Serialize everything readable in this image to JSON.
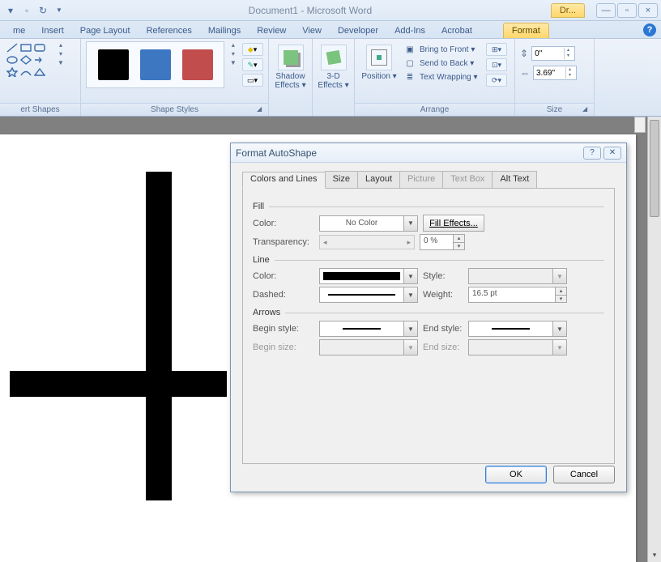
{
  "titlebar": {
    "title": "Document1 - Microsoft Word",
    "tool_tab": "Dr..."
  },
  "ribbon_tabs": {
    "t0": "me",
    "insert": "Insert",
    "page_layout": "Page Layout",
    "references": "References",
    "mailings": "Mailings",
    "review": "Review",
    "view": "View",
    "developer": "Developer",
    "addins": "Add-Ins",
    "acrobat": "Acrobat",
    "format": "Format"
  },
  "groups": {
    "insert_shapes": "ert Shapes",
    "shape_styles": "Shape Styles",
    "shadow": {
      "label": "Shadow Effects ▾"
    },
    "threeD": {
      "label": "3-D Effects ▾"
    },
    "position": {
      "label": "Position ▾"
    },
    "arrange": "Arrange",
    "bring_front": "Bring to Front ▾",
    "send_back": "Send to Back ▾",
    "text_wrap": "Text Wrapping ▾",
    "size": "Size",
    "height": "0\"",
    "width": "3.69\""
  },
  "dialog": {
    "title": "Format AutoShape",
    "tabs": {
      "colors_lines": "Colors and Lines",
      "size": "Size",
      "layout": "Layout",
      "picture": "Picture",
      "text_box": "Text Box",
      "alt_text": "Alt Text"
    },
    "fill": {
      "group": "Fill",
      "color_label": "Color:",
      "color_value": "No Color",
      "effects_btn": "Fill Effects...",
      "transparency_label": "Transparency:",
      "transparency_value": "0 %"
    },
    "line": {
      "group": "Line",
      "color_label": "Color:",
      "dashed_label": "Dashed:",
      "style_label": "Style:",
      "weight_label": "Weight:",
      "weight_value": "16.5 pt"
    },
    "arrows": {
      "group": "Arrows",
      "begin_style": "Begin style:",
      "end_style": "End style:",
      "begin_size": "Begin size:",
      "end_size": "End size:"
    },
    "buttons": {
      "ok": "OK",
      "cancel": "Cancel"
    }
  }
}
